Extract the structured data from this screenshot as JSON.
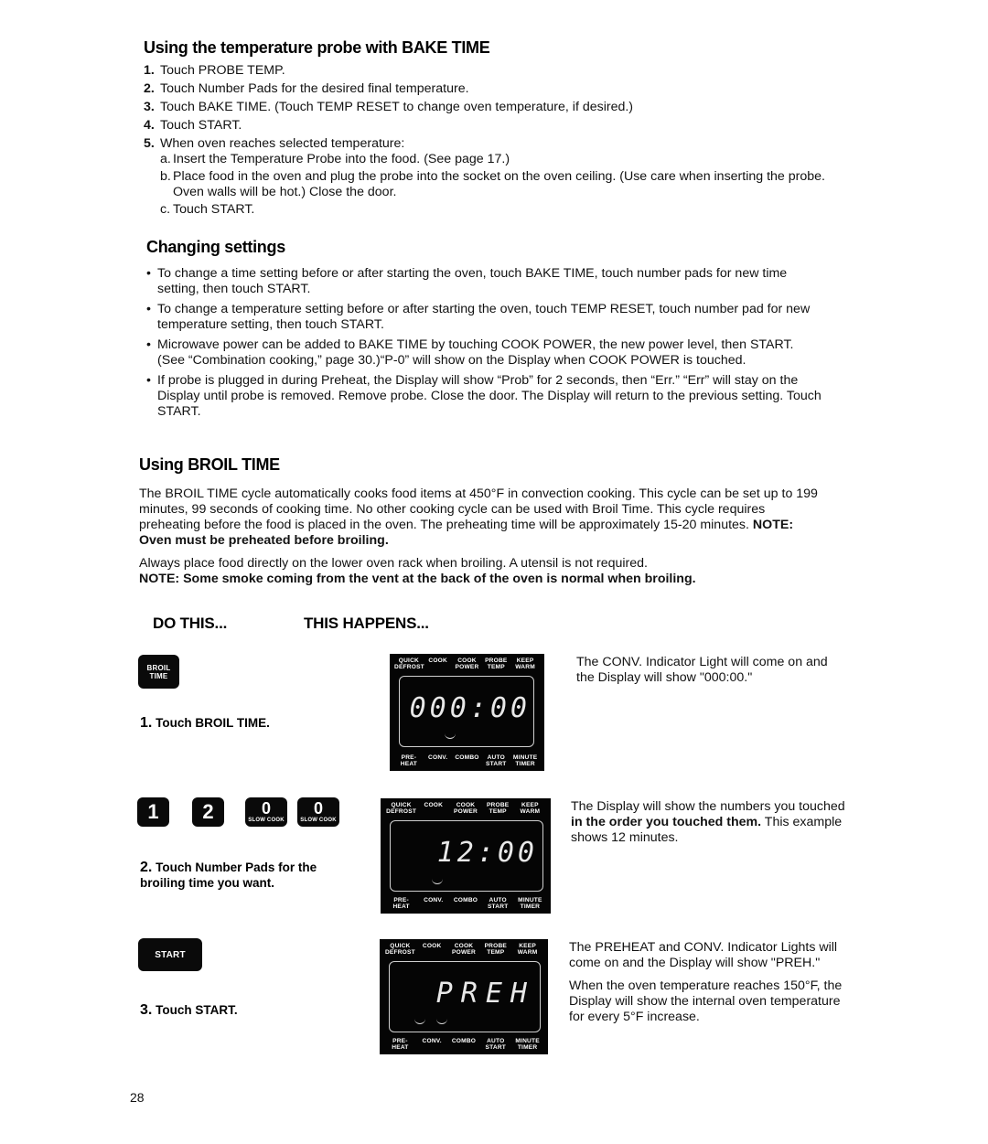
{
  "section_probe": {
    "title": "Using the temperature probe with BAKE TIME",
    "steps": [
      {
        "n": "1.",
        "text": "Touch PROBE TEMP."
      },
      {
        "n": "2.",
        "text": "Touch Number Pads for the desired final temperature."
      },
      {
        "n": "3.",
        "text": "Touch BAKE TIME. (Touch TEMP RESET to change oven temperature, if desired.)"
      },
      {
        "n": "4.",
        "text": "Touch START."
      },
      {
        "n": "5.",
        "text": "When oven reaches selected temperature:"
      }
    ],
    "substeps": [
      {
        "n": "a.",
        "text": "Insert the Temperature Probe into the food. (See page 17.)"
      },
      {
        "n": "b.",
        "text": "Place food in the oven and plug the probe into the socket on the oven ceiling. (Use care when inserting the probe. Oven walls will be hot.) Close the door."
      },
      {
        "n": "c.",
        "text": "Touch START."
      }
    ]
  },
  "section_changing": {
    "title": "Changing settings",
    "bullets": [
      "To change a time setting before or after starting the oven, touch BAKE TIME, touch number pads for new time setting, then touch START.",
      "To change a temperature setting before or after starting the oven, touch TEMP RESET, touch number pad for new temperature setting, then touch START.",
      "Microwave power can be added to BAKE TIME by touching COOK POWER, the new power level, then START. (See “Combination cooking,” page 30.)“P-0” will show on the Display when COOK POWER is touched.",
      "If probe is plugged in during Preheat, the Display will show “Prob” for 2 seconds, then “Err.” “Err” will stay on the Display until probe is removed. Remove probe. Close the door. The Display will return to the previous setting. Touch START."
    ]
  },
  "section_broil": {
    "title": "Using BROIL TIME",
    "para1": "The BROIL TIME cycle automatically cooks food items at 450°F in convection cooking. This cycle can be set up to 199 minutes, 99 seconds of cooking time. No other cooking cycle can be used with Broil Time. This cycle requires preheating before the food is placed in the oven. The preheating time will be approximately 15-20 minutes.",
    "para1_note": "NOTE: Oven must be preheated before broiling.",
    "para2": "Always place food directly on the lower oven rack when broiling. A utensil is not required.",
    "para2_note": "NOTE: Some smoke coming from the vent at the back of the oven is normal when broiling."
  },
  "columns": {
    "do_this": "DO THIS...",
    "this_happens": "THIS HAPPENS..."
  },
  "display_labels": {
    "top": [
      {
        "l1": "QUICK",
        "l2": "DEFROST"
      },
      {
        "l1": "COOK",
        "l2": ""
      },
      {
        "l1": "COOK",
        "l2": "POWER"
      },
      {
        "l1": "PROBE",
        "l2": "TEMP"
      },
      {
        "l1": "KEEP",
        "l2": "WARM"
      }
    ],
    "bottom": [
      {
        "l1": "PRE-",
        "l2": "HEAT"
      },
      {
        "l1": "CONV.",
        "l2": ""
      },
      {
        "l1": "COMBO",
        "l2": ""
      },
      {
        "l1": "AUTO",
        "l2": "START"
      },
      {
        "l1": "MINUTE",
        "l2": "TIMER"
      }
    ]
  },
  "steps": [
    {
      "keys": [
        {
          "line1": "BROIL",
          "line2": "TIME"
        }
      ],
      "label_num": "1.",
      "label_text": "Touch BROIL TIME.",
      "display": "000:00",
      "desc": "The CONV. Indicator Light will come on and the Display will show \"000:00.\""
    },
    {
      "keys": [
        {
          "digit": "1",
          "sub": ""
        },
        {
          "digit": "2",
          "sub": ""
        },
        {
          "digit": "0",
          "sub": "SLOW COOK"
        },
        {
          "digit": "0",
          "sub": "SLOW COOK"
        }
      ],
      "label_num": "2.",
      "label_text": "Touch Number Pads for the broiling time you want.",
      "display": "12:00",
      "desc_plain1": "The Display will show the numbers you touched",
      "desc_bold": "in the order you touched them.",
      "desc_plain2": "This example shows 12 minutes."
    },
    {
      "keys": [
        {
          "line1": "START"
        }
      ],
      "label_num": "3.",
      "label_text": "Touch START.",
      "display": "PREH",
      "desc": "The PREHEAT and CONV. Indicator Lights will come on and the Display will show \"PREH.\"",
      "desc2": "When the oven temperature reaches 150°F, the Display will show the internal oven temperature for every 5°F increase."
    }
  ],
  "page_number": "28"
}
